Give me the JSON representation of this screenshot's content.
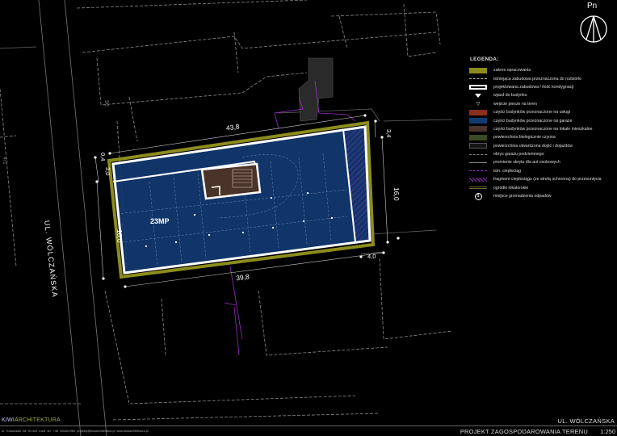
{
  "north": {
    "label": "Pn"
  },
  "plan": {
    "street_label": "UL. WÓLCZAŃSKA",
    "parking_count": "23MP",
    "neighbor_number": "96",
    "neighbor_number_2": "4/1",
    "dims": {
      "top": "43,8",
      "bottom": "39,8",
      "right_side": "16,0",
      "left_side": "16,0",
      "top_right": "3,4",
      "bottom_right": "4,0",
      "top_left_a": "0,4",
      "top_left_b": "3,0"
    }
  },
  "legend": {
    "title": "LEGENDA:",
    "items": [
      {
        "label": "zakres opracowania",
        "swatch": "fill",
        "color": "#8c8c1e"
      },
      {
        "label": "istniejąca zabudowa przeznaczona do rozbiórki",
        "swatch": "dashed",
        "color": "#bbbbbb"
      },
      {
        "label": "projektowana zabudowa / ilość kondygnacji",
        "swatch": "outline-bold",
        "color": "#ffffff"
      },
      {
        "label": "wjazd do budynku",
        "swatch": "triangle-solid",
        "color": "#ffffff"
      },
      {
        "label": "wejście piesze na teren",
        "swatch": "triangle-outline",
        "color": "#ffffff"
      },
      {
        "label": "części budynków przeznaczone na usługi",
        "swatch": "fill",
        "color": "#8a2e1e"
      },
      {
        "label": "części budynków przeznaczone na garaże",
        "swatch": "fill",
        "color": "#123a72"
      },
      {
        "label": "części budynków przeznaczone na lokale mieszkalne",
        "swatch": "fill",
        "color": "#4a3328"
      },
      {
        "label": "powierzchnia biologicznie czynna",
        "swatch": "fill",
        "color": "#3b4a22"
      },
      {
        "label": "powierzchnia utwardzona dojść i dojazdów",
        "swatch": "fill-outline",
        "color": "#151515"
      },
      {
        "label": "obrys garażu podziemnego",
        "swatch": "dashed",
        "color": "#888888"
      },
      {
        "label": "promienie skrętu dla aut osobowych",
        "swatch": "line",
        "color": "#8a8a8a"
      },
      {
        "label": "istn. ciepłociąg",
        "swatch": "dashed",
        "color": "#9a2fc8"
      },
      {
        "label": "fragment ciepłociągu (ze strefą ochronną) do przesunięcia",
        "swatch": "hatch",
        "color": "#9a2fc8"
      },
      {
        "label": "ogródki lokatorskie",
        "swatch": "line-double",
        "color": "#6a6a2a"
      },
      {
        "label": "miejsce gromadzenia odpadów",
        "swatch": "circle-s",
        "color": "#ffffff"
      }
    ]
  },
  "footer": {
    "firm_k": "KIWI",
    "firm_a": "ARCHITEKTURA",
    "contact": "ul. Kościuszki 28  90-419 Łódź       tel. +48 426321989       projekty@kiwiarchitektura.pl       www.kiwiarchitektura.pl",
    "street": "UL. WÓLCZAŃSKA",
    "project": "PROJEKT ZAGOSPODAROWANIA TERENU",
    "scale": "1:250"
  }
}
